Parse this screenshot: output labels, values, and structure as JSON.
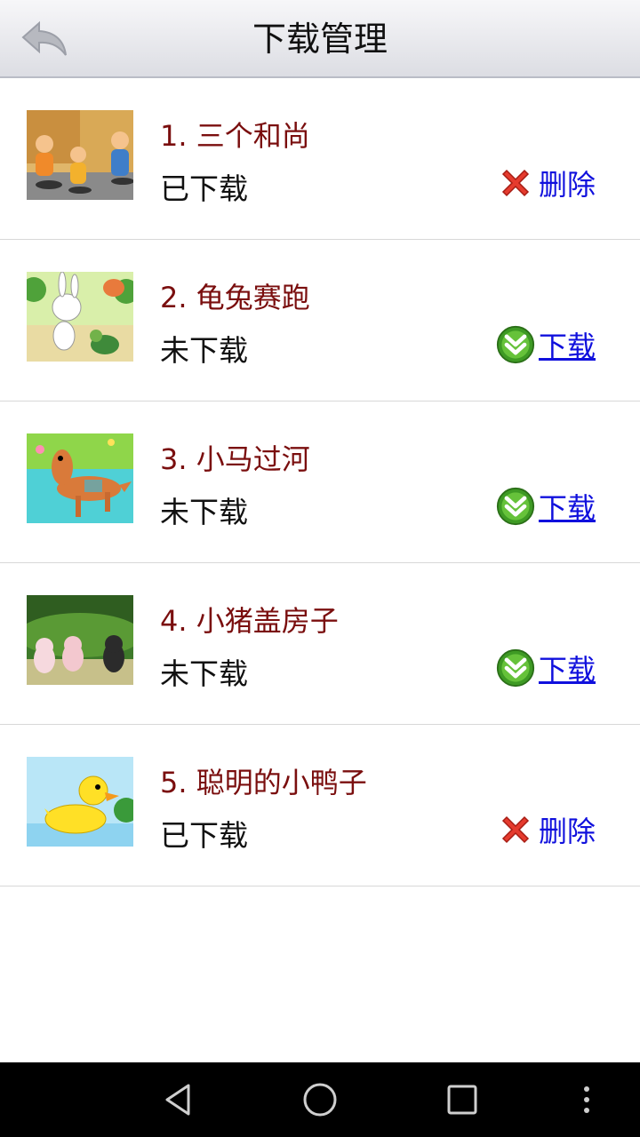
{
  "header": {
    "title": "下载管理",
    "back_icon": "back-arrow-icon"
  },
  "items": [
    {
      "title": "1. 三个和尚",
      "status": "已下载",
      "action": "删除",
      "action_type": "delete",
      "thumb": "three-monks-thumbnail"
    },
    {
      "title": "2. 龟兔赛跑",
      "status": "未下载",
      "action": "下载",
      "action_type": "download",
      "thumb": "tortoise-hare-thumbnail"
    },
    {
      "title": "3. 小马过河",
      "status": "未下载",
      "action": "下载",
      "action_type": "download",
      "thumb": "pony-river-thumbnail"
    },
    {
      "title": "4. 小猪盖房子",
      "status": "未下载",
      "action": "下载",
      "action_type": "download",
      "thumb": "pigs-house-thumbnail"
    },
    {
      "title": "5. 聪明的小鸭子",
      "status": "已下载",
      "action": "删除",
      "action_type": "delete",
      "thumb": "duck-thumbnail"
    }
  ],
  "colors": {
    "title_text": "#7a0e0e",
    "action_link": "#1010dd",
    "delete_icon": "#e53b2e",
    "download_icon": "#3e9a24"
  },
  "navbar": {
    "back_icon": "triangle-back-icon",
    "home_icon": "circle-home-icon",
    "recents_icon": "square-recents-icon",
    "menu_icon": "vertical-dots-menu-icon"
  }
}
